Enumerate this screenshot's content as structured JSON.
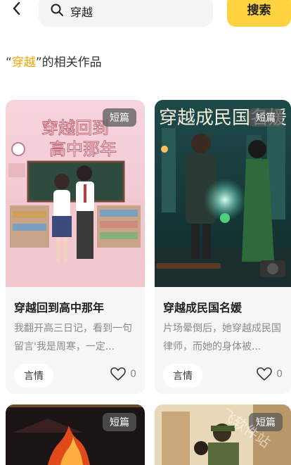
{
  "search": {
    "query": "穿越",
    "button_label": "搜索"
  },
  "result_heading": {
    "open_quote": "“",
    "keyword": "穿越",
    "rest": "”的相关作品"
  },
  "cards": [
    {
      "tag": "短篇",
      "cover_text": "穿越回到高中那年",
      "title": "穿越回到高中那年",
      "desc": "我翻开高三日记，看到一句留言'我是周寒，一定...",
      "genre": "言情",
      "likes": "0"
    },
    {
      "tag": "短篇",
      "cover_text": "穿越成民国名媛",
      "title": "穿越成民国名媛",
      "desc": "片场晕倒后，她穿越成民国律师，而她的身体被...",
      "genre": "言情",
      "likes": "0"
    },
    {
      "tag": "短篇"
    },
    {
      "tag": "短篇"
    }
  ],
  "watermark": "飞软件站",
  "colors": {
    "accent": "#ffd23f",
    "keyword": "#f0a500"
  }
}
